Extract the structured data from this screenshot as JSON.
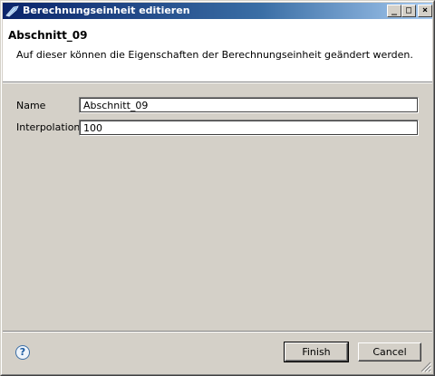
{
  "window": {
    "title": "Berechnungseinheit editieren",
    "minimize_symbol": "_",
    "maximize_symbol": "□",
    "close_symbol": "×"
  },
  "header": {
    "title": "Abschnitt_09",
    "description": "Auf dieser können die Eigenschaften der Berechnungseinheit geändert werden."
  },
  "form": {
    "name_label": "Name",
    "name_value": "Abschnitt_09",
    "interpolation_label": "Interpolation",
    "interpolation_value": "100"
  },
  "footer": {
    "help_symbol": "?",
    "finish_label": "Finish",
    "cancel_label": "Cancel"
  },
  "icons": {
    "title": "app-logo-icon",
    "help": "help-icon",
    "grip": "resize-grip-icon"
  },
  "colors": {
    "titlebar_start": "#0a246a",
    "titlebar_end": "#a6caf0",
    "dialog_bg": "#d4d0c8"
  }
}
